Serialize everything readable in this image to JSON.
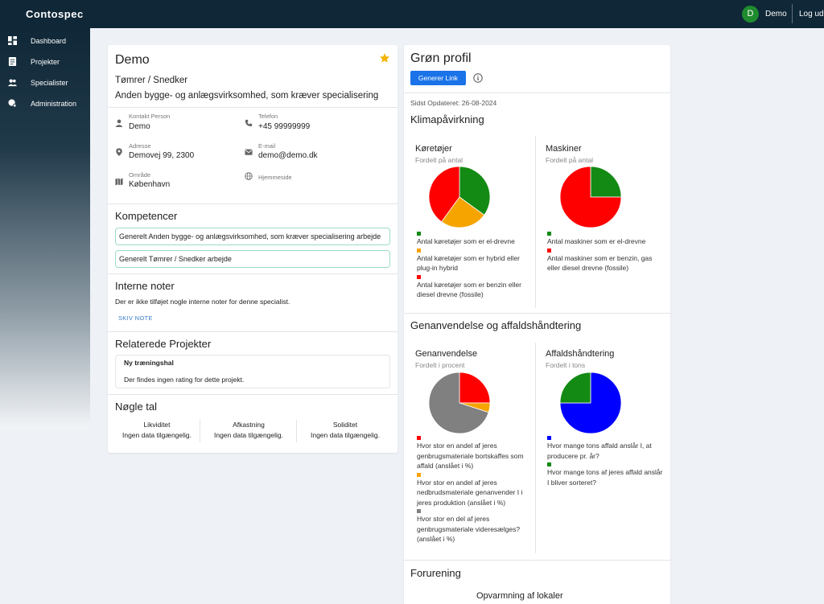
{
  "topbar": {
    "app_name": "Contospec",
    "avatar_initial": "D",
    "username": "Demo",
    "logout": "Log ud"
  },
  "sidebar": {
    "items": [
      {
        "label": "Dashboard",
        "icon": "dashboard-icon"
      },
      {
        "label": "Projekter",
        "icon": "document-icon"
      },
      {
        "label": "Specialister",
        "icon": "people-icon"
      },
      {
        "label": "Administration",
        "icon": "admin-icon"
      }
    ]
  },
  "profile": {
    "name": "Demo",
    "role": "Tømrer / Snedker",
    "description": "Anden bygge- og anlægsvirksomhed, som kræver specialisering",
    "contact_label": "Kontakt Person",
    "contact_value": "Demo",
    "phone_label": "Telefon",
    "phone_value": "+45 99999999",
    "address_label": "Adresse",
    "address_value": "Demovej 99, 2300",
    "email_label": "E-mail",
    "email_value": "demo@demo.dk",
    "area_label": "Område",
    "area_value": "København",
    "website_label": "Hjemmeside"
  },
  "competencies": {
    "title": "Kompetencer",
    "items": [
      "Generelt Anden bygge- og anlægsvirksomhed, som kræver specialisering arbejde",
      "Generelt Tømrer / Snedker arbejde"
    ]
  },
  "notes": {
    "title": "Interne noter",
    "text": "Der er ikke tilføjet nogle interne noter for denne specialist.",
    "button": "SKIV NOTE"
  },
  "related_projects": {
    "title": "Relaterede Projekter",
    "project_name": "Ny træningshal",
    "project_text": "Der findes ingen rating for dette projekt."
  },
  "key_figures": {
    "title": "Nøgle tal",
    "items": [
      {
        "label": "Likviditet",
        "value": "Ingen data tilgængelig."
      },
      {
        "label": "Afkastning",
        "value": "Ingen data tilgængelig."
      },
      {
        "label": "Soliditet",
        "value": "Ingen data tilgængelig."
      }
    ]
  },
  "green_profile": {
    "title": "Grøn profil",
    "generate_button": "Generer Link",
    "updated": "Sidst Opdateret: 26-08-2024",
    "climate_title": "Klimapåvirkning",
    "recycling_title": "Genanvendelse og affaldshåndtering",
    "pollution_title": "Forurening",
    "heating_label": "Opvarmning af lokaler"
  },
  "colors": {
    "green": "#138a13",
    "orange": "#f5a400",
    "red": "#ff0000",
    "blue": "#0000ff",
    "grey": "#808080",
    "accent": "#1a73e8"
  },
  "chart_data": [
    {
      "type": "pie",
      "title": "Køretøjer",
      "subtitle": "Fordelt på antal",
      "series": [
        {
          "values": [
            35,
            25,
            40
          ]
        }
      ],
      "categories": [
        "Antal køretøjer som er el-drevne",
        "Antal køretøjer som er hybrid eller plug-in hybrid",
        "Antal køretøjer som er benzin eller diesel drevne (fossile)"
      ],
      "colors": [
        "#138a13",
        "#f5a400",
        "#ff0000"
      ]
    },
    {
      "type": "pie",
      "title": "Maskiner",
      "subtitle": "Fordelt på antal",
      "series": [
        {
          "values": [
            25,
            75
          ]
        }
      ],
      "categories": [
        "Antal maskiner som er el-drevne",
        "Antal maskiner som er benzin, gas eller diesel drevne (fossile)"
      ],
      "colors": [
        "#138a13",
        "#ff0000"
      ]
    },
    {
      "type": "pie",
      "title": "Genanvendelse",
      "subtitle": "Fordelt i procent",
      "series": [
        {
          "values": [
            25,
            5,
            70
          ]
        }
      ],
      "categories": [
        "Hvor stor en andel af jeres genbrugsmateriale bortskaffes som affald (anslået i %)",
        "Hvor stor en andel af jeres nedbrudsmateriale genanvender I i jeres produktion (anslået i %)",
        "Hvor stor en del af jeres genbrugsmateriale videresælges? (anslået i %)"
      ],
      "colors": [
        "#ff0000",
        "#f5a400",
        "#808080"
      ]
    },
    {
      "type": "pie",
      "title": "Affaldshåndtering",
      "subtitle": "Fordelt i tons",
      "series": [
        {
          "values": [
            75,
            25
          ]
        }
      ],
      "categories": [
        "Hvor mange tons affald anslår I, at producere pr. år?",
        "Hvor mange tons af jeres affald anslår I bliver sorteret?"
      ],
      "colors": [
        "#0000ff",
        "#138a13"
      ]
    }
  ]
}
